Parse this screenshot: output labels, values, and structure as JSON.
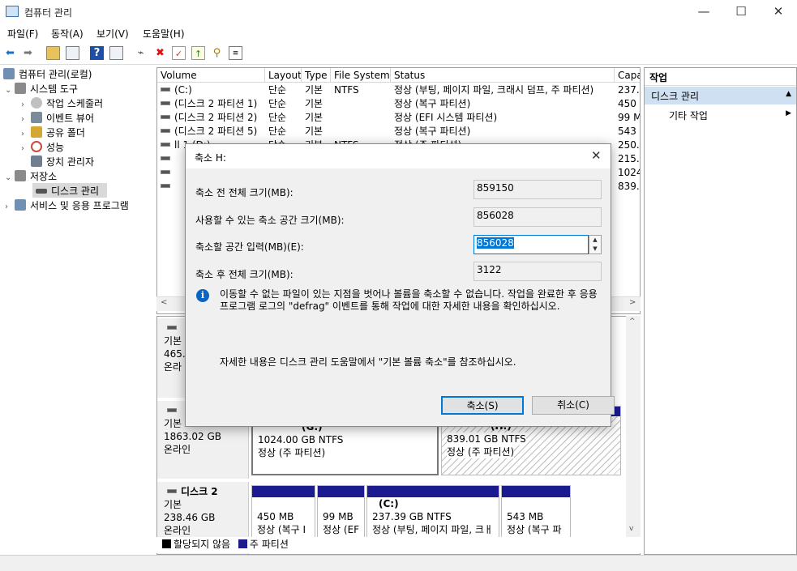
{
  "window": {
    "title": "컴퓨터 관리",
    "minimize": "—",
    "maximize": "☐",
    "close": "✕"
  },
  "menu": [
    "파일(F)",
    "동작(A)",
    "보기(V)",
    "도움말(H)"
  ],
  "toolbar_icons": [
    "back-icon",
    "forward-icon",
    "up-folder-icon",
    "console-tree-icon",
    "help-icon",
    "view-icon",
    "connect-icon",
    "delete-icon",
    "properties-icon",
    "import-icon",
    "search-icon",
    "export-icon"
  ],
  "tree": [
    {
      "label": "컴퓨터 관리(로컬)",
      "arrow": "",
      "icon_color": "#6f8fb3"
    },
    {
      "label": "시스템 도구",
      "arrow": "⌄",
      "icon_color": "#8a8a8a"
    },
    {
      "label": "작업 스케줄러",
      "arrow": "›",
      "icon_color": "#c0c0c0"
    },
    {
      "label": "이벤트 뷰어",
      "arrow": "›",
      "icon_color": "#7a8c9a"
    },
    {
      "label": "공유 폴더",
      "arrow": "›",
      "icon_color": "#d4a733"
    },
    {
      "label": "성능",
      "arrow": "›",
      "icon_color": "#c94b3b"
    },
    {
      "label": "장치 관리자",
      "arrow": "",
      "icon_color": "#6f7f8f"
    },
    {
      "label": "저장소",
      "arrow": "⌄",
      "icon_color": "#8a8a8a"
    },
    {
      "label": "디스크 관리",
      "arrow": "",
      "icon_color": "#555555"
    },
    {
      "label": "서비스 및 응용 프로그램",
      "arrow": "›",
      "icon_color": "#6f8fb3"
    }
  ],
  "volume_table": {
    "columns": [
      "Volume",
      "Layout",
      "Type",
      "File System",
      "Status",
      "Capa"
    ],
    "rows": [
      [
        "(C:)",
        "단순",
        "기본",
        "NTFS",
        "정상 (부팅, 페이지 파일, 크래시 덤프, 주 파티션)",
        "237.3"
      ],
      [
        "(디스크 2 파티션 1)",
        "단순",
        "기본",
        "",
        "정상 (복구 파티션)",
        "450 I"
      ],
      [
        "(디스크 2 파티션 2)",
        "단순",
        "기본",
        "",
        "정상 (EFI 시스템 파티션)",
        "99 M"
      ],
      [
        "(디스크 2 파티션 5)",
        "단순",
        "기본",
        "",
        "정상 (복구 파티션)",
        "543 I"
      ],
      [
        "ll 1 (D:)",
        "단순",
        "기본",
        "NTFS",
        "정상 (주 파티션)",
        "250.0"
      ],
      [
        "",
        "",
        "",
        "",
        "",
        "215.7"
      ],
      [
        "",
        "",
        "",
        "",
        "",
        "1024"
      ],
      [
        "",
        "",
        "",
        "",
        "",
        "839.0"
      ]
    ]
  },
  "disks": [
    {
      "name": "",
      "lines": [
        "기본",
        "465.",
        "온라"
      ]
    },
    {
      "name": "",
      "lines": [
        "기본",
        "1863.02 GB",
        "온라인"
      ],
      "partitions": [
        {
          "name": "(G:)",
          "size": "1024.00 GB NTFS",
          "status": "정상 (주 파티션)"
        },
        {
          "name": "(H:)",
          "size": "839.01 GB NTFS",
          "status": "정상 (주 파티션)"
        }
      ]
    },
    {
      "name": "디스크 2",
      "lines": [
        "기본",
        "238.46 GB",
        "온라인"
      ],
      "partitions": [
        {
          "name": "",
          "size": "450 MB",
          "status": "정상 (복구 I"
        },
        {
          "name": "",
          "size": "99 MB",
          "status": "정상 (EF"
        },
        {
          "name": "(C:)",
          "size": "237.39 GB NTFS",
          "status": "정상 (부팅, 페이지 파일, 크ㅐ"
        },
        {
          "name": "",
          "size": "543 MB",
          "status": "정상 (복구 파"
        }
      ]
    }
  ],
  "legend": {
    "unallocated": "할당되지 않음",
    "primary": "주 파티션"
  },
  "actions": {
    "header": "작업",
    "section": "디스크 관리",
    "more": "기타 작업"
  },
  "dialog": {
    "title": "축소 H:",
    "total_before_label": "축소 전 전체 크기(MB):",
    "total_before": "859150",
    "available_label": "사용할 수 있는 축소 공간 크기(MB):",
    "available": "856028",
    "amount_label": "축소할 공간 입력(MB)(E):",
    "amount": "856028",
    "total_after_label": "축소 후 전체 크기(MB):",
    "total_after": "3122",
    "info": "이동할 수 없는 파일이 있는 지점을 벗어나 볼륨을 축소할 수 없습니다. 작업을 완료한 후 응용 프로그램 로그의 \"defrag\" 이벤트를 통해 작업에 대한 자세한 내용을 확인하십시오.",
    "help": "자세한 내용은 디스크 관리 도움말에서 \"기본 볼륨 축소\"를 참조하십시오.",
    "ok": "축소(S)",
    "cancel": "취소(C)"
  },
  "colors": {
    "primary_partition": "#1b1b8f",
    "selection": "#cce4f7",
    "dialog_bg": "#f0f0f0"
  }
}
